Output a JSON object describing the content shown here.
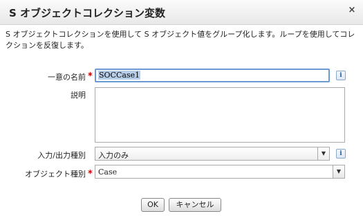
{
  "dialog": {
    "title": "S オブジェクトコレクション変数",
    "close_glyph": "×",
    "description": "S オブジェクトコレクションを使用して S オブジェクト値をグループ化します。ループを使用してコレクションを反復します。"
  },
  "form": {
    "unique_name": {
      "label": "一意の名前",
      "required_mark": "*",
      "value": "SOCCase1",
      "info_glyph": "i"
    },
    "description": {
      "label": "説明",
      "value": ""
    },
    "io_type": {
      "label": "入力/出力種別",
      "value": "入力のみ",
      "arrow_glyph": "▼",
      "info_glyph": "i"
    },
    "object_type": {
      "label": "オブジェクト種別",
      "required_mark": "*",
      "value": "Case",
      "arrow_glyph": "▼"
    }
  },
  "buttons": {
    "ok_label": "OK",
    "cancel_label": "キャンセル"
  },
  "colors": {
    "required": "#cc0000",
    "focus_border": "#6a9ad1",
    "selection": "#b7cde8"
  }
}
